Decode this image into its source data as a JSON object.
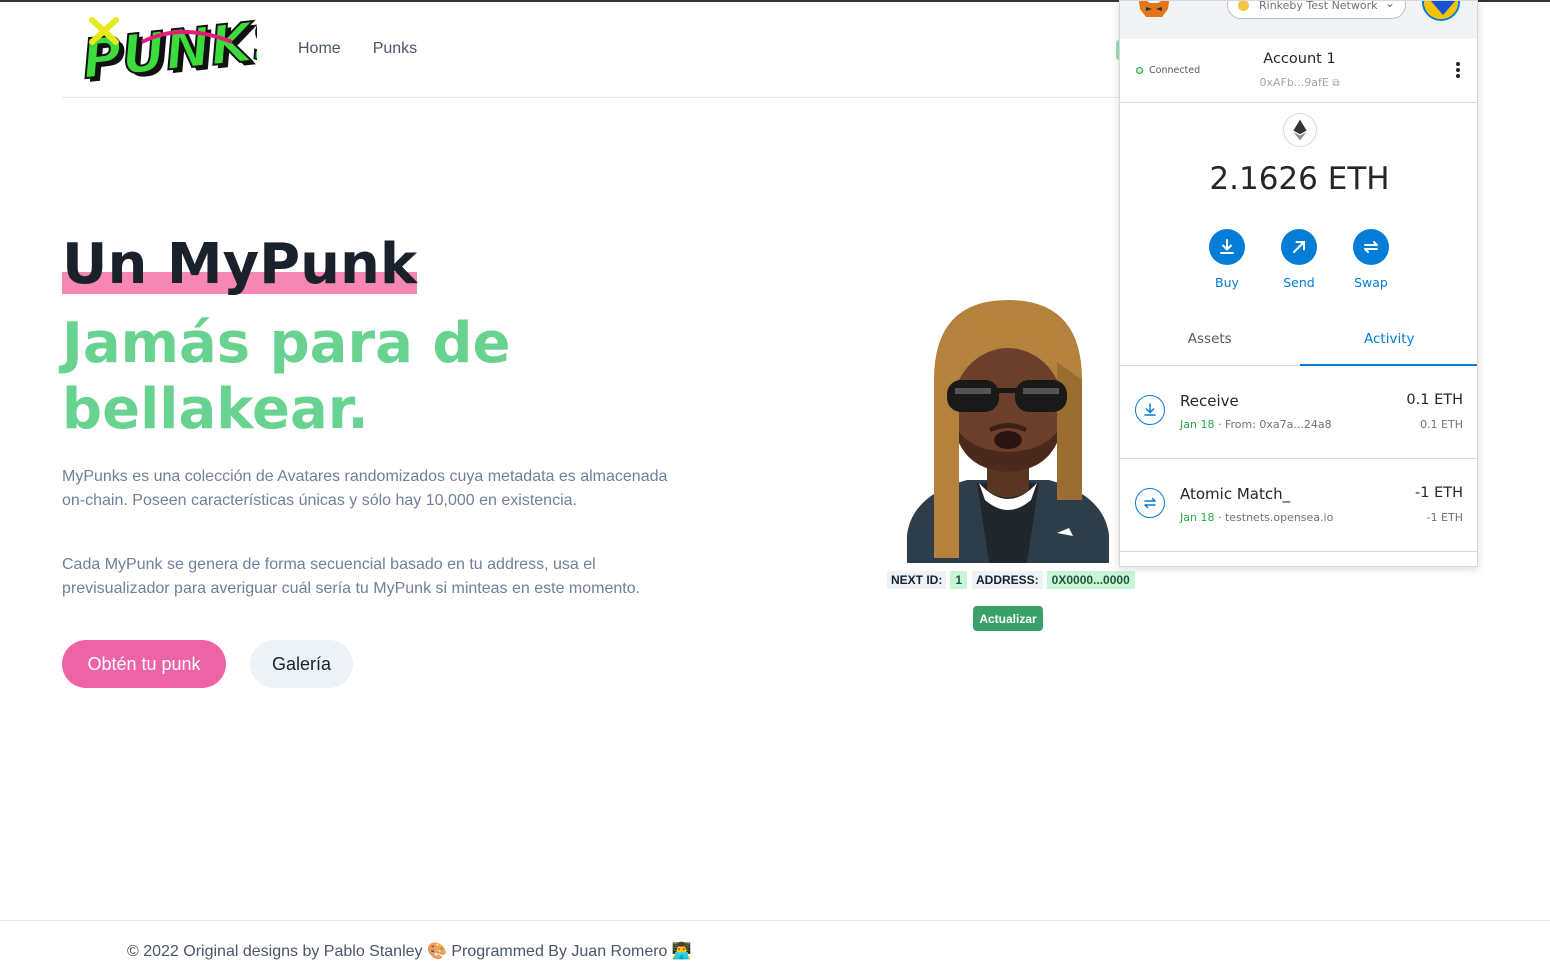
{
  "nav": {
    "home": "Home",
    "punks": "Punks"
  },
  "logo": {
    "text": "PUNKS"
  },
  "hero": {
    "title_line1": "Un MyPunk",
    "title_line2": "Jamás para de bellakear.",
    "paragraph1": "MyPunks es una colección de Avatares randomizados cuya metadata es almacenada on-chain. Poseen características únicas y sólo hay 10,000 en existencia.",
    "paragraph2": "Cada MyPunk se genera de forma secuencial basado en tu address, usa el previsualizador para averiguar cuál sería tu MyPunk si minteas en este momento.",
    "primary_button": "Obtén tu punk",
    "secondary_button": "Galería"
  },
  "preview": {
    "next_id_label": "NEXT ID:",
    "next_id_value": "1",
    "address_label": "ADDRESS:",
    "address_value": "0X0000...0000",
    "update_button": "Actualizar"
  },
  "metamask": {
    "network": "Rinkeby Test Network",
    "connected": "Connected",
    "account_name": "Account 1",
    "account_address": "0xAFb...9afE",
    "balance": "2.1626 ETH",
    "actions": [
      "Buy",
      "Send",
      "Swap"
    ],
    "tabs": [
      "Assets",
      "Activity"
    ],
    "active_tab": "Activity",
    "transactions": [
      {
        "title": "Receive",
        "date": "Jan 18",
        "detail": "From: 0xa7a...24a8",
        "amount": "0.1 ETH",
        "amount2": "0.1 ETH",
        "icon": "receive-icon"
      },
      {
        "title": "Atomic Match_",
        "date": "Jan 18",
        "detail": "testnets.opensea.io",
        "amount": "-1 ETH",
        "amount2": "-1 ETH",
        "icon": "swap-icon"
      }
    ]
  },
  "footer": {
    "text1": "© 2022 Original designs by Pablo Stanley",
    "text2": "Programmed By Juan Romero"
  },
  "colors": {
    "pink": "#ed64a6",
    "green": "#68d391",
    "metamask_blue": "#037dd6"
  }
}
